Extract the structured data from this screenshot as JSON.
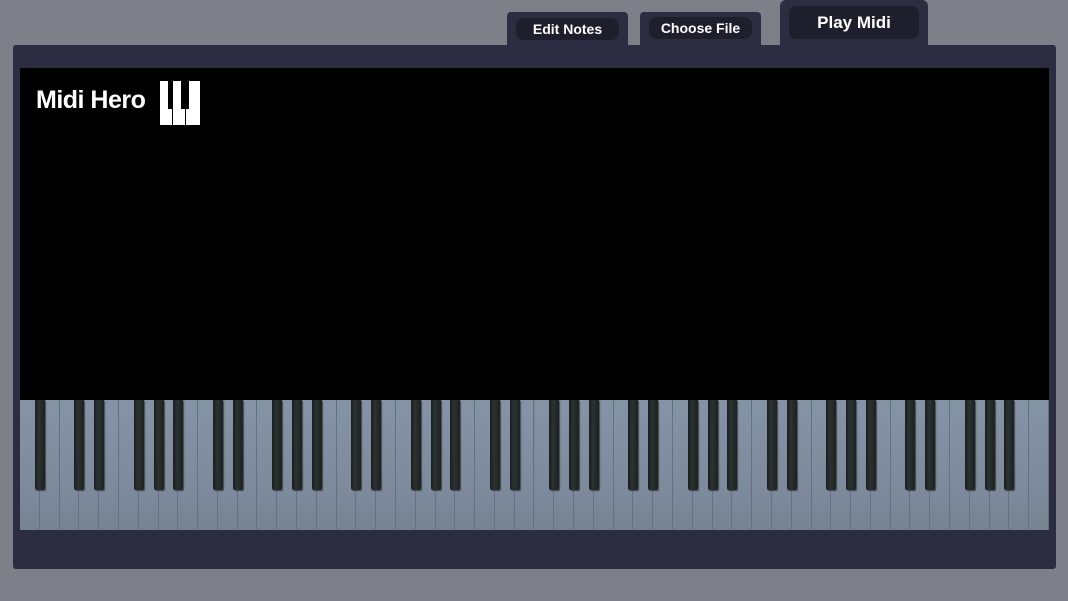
{
  "tabs": {
    "edit_notes": "Edit Notes",
    "choose_file": "Choose File",
    "play_midi": "Play Midi"
  },
  "app": {
    "title": "Midi Hero",
    "logo_icon": "piano-keys-icon"
  },
  "keyboard": {
    "white_key_count": 52,
    "black_key_count": 36
  },
  "colors": {
    "background": "#7d8089",
    "panel": "#2c2d40",
    "stage": "#000000",
    "white_key": "#8593a6",
    "black_key": "#1c2120"
  }
}
